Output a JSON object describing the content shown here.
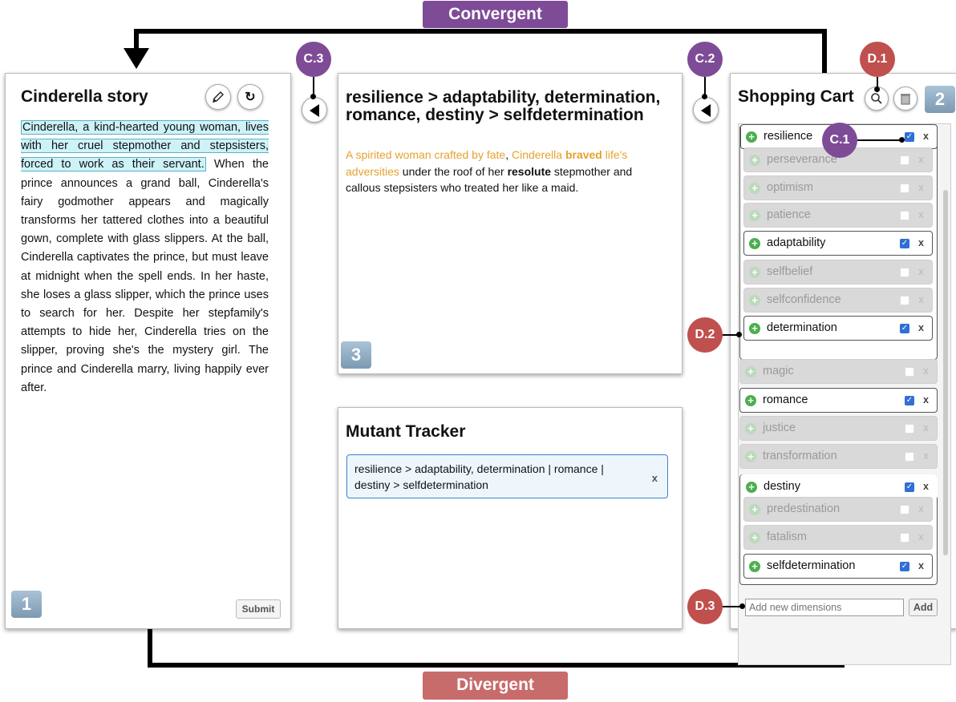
{
  "banners": {
    "convergent": "Convergent",
    "divergent": "Divergent"
  },
  "story_panel": {
    "title": "Cinderella story",
    "highlighted_text": "Cinderella, a kind-hearted young woman, lives with her cruel stepmother and stepsisters, forced to work as their servant.",
    "body_text": " When the prince announces a grand ball, Cinderella's fairy godmother appears and magically transforms her tattered clothes into a beautiful gown, complete with glass slippers. At the ball, Cinderella captivates the prince, but must leave at midnight when the spell ends. In her haste, she loses a glass slipper, which the prince uses to search for her. Despite her stepfamily's attempts to hide her, Cinderella tries on the slipper, proving she's the mystery girl. The prince and Cinderella marry, living happily ever after.",
    "badge": "1",
    "submit_label": "Submit",
    "edit_icon": "pencil-icon",
    "refresh_icon": "refresh-icon"
  },
  "rewrite_panel": {
    "title": "resilience > adaptability, determination, romance, destiny > selfdetermination",
    "text_parts": {
      "p1": "A spirited woman crafted by fate",
      "p2": ", ",
      "p3": "Cinderella ",
      "p4": "braved",
      "p5": " life's adversities",
      "p6": " under the roof of her ",
      "p7": "resolute",
      "p8": " stepmother and callous stepsisters who treated her like a maid."
    },
    "badge": "3"
  },
  "mutant_panel": {
    "title": "Mutant Tracker",
    "entry": "resilience > adaptability, determination | romance | destiny > selfdetermination",
    "remove_label": "x"
  },
  "cart_panel": {
    "title": "Shopping Cart",
    "badge": "2",
    "search_icon": "search-icon",
    "trash_icon": "trash-icon",
    "items": [
      {
        "label": "resilience",
        "checked": true
      },
      {
        "label": "perseverance",
        "checked": false
      },
      {
        "label": "optimism",
        "checked": false
      },
      {
        "label": "patience",
        "checked": false
      },
      {
        "label": "adaptability",
        "checked": true
      },
      {
        "label": "selfbelief",
        "checked": false
      },
      {
        "label": "selfconfidence",
        "checked": false
      },
      {
        "label": "determination",
        "checked": true
      },
      {
        "label": "magic",
        "checked": false
      },
      {
        "label": "romance",
        "checked": true
      },
      {
        "label": "justice",
        "checked": false
      },
      {
        "label": "transformation",
        "checked": false
      },
      {
        "label": "destiny",
        "checked": true
      },
      {
        "label": "predestination",
        "checked": false
      },
      {
        "label": "fatalism",
        "checked": false
      },
      {
        "label": "selfdetermination",
        "checked": true
      }
    ],
    "remove_label": "x",
    "add_placeholder": "Add new dimensions",
    "add_label": "Add"
  },
  "callouts": {
    "c1": "C.1",
    "c2": "C.2",
    "c3": "C.3",
    "d1": "D.1",
    "d2": "D.2",
    "d3": "D.3"
  }
}
